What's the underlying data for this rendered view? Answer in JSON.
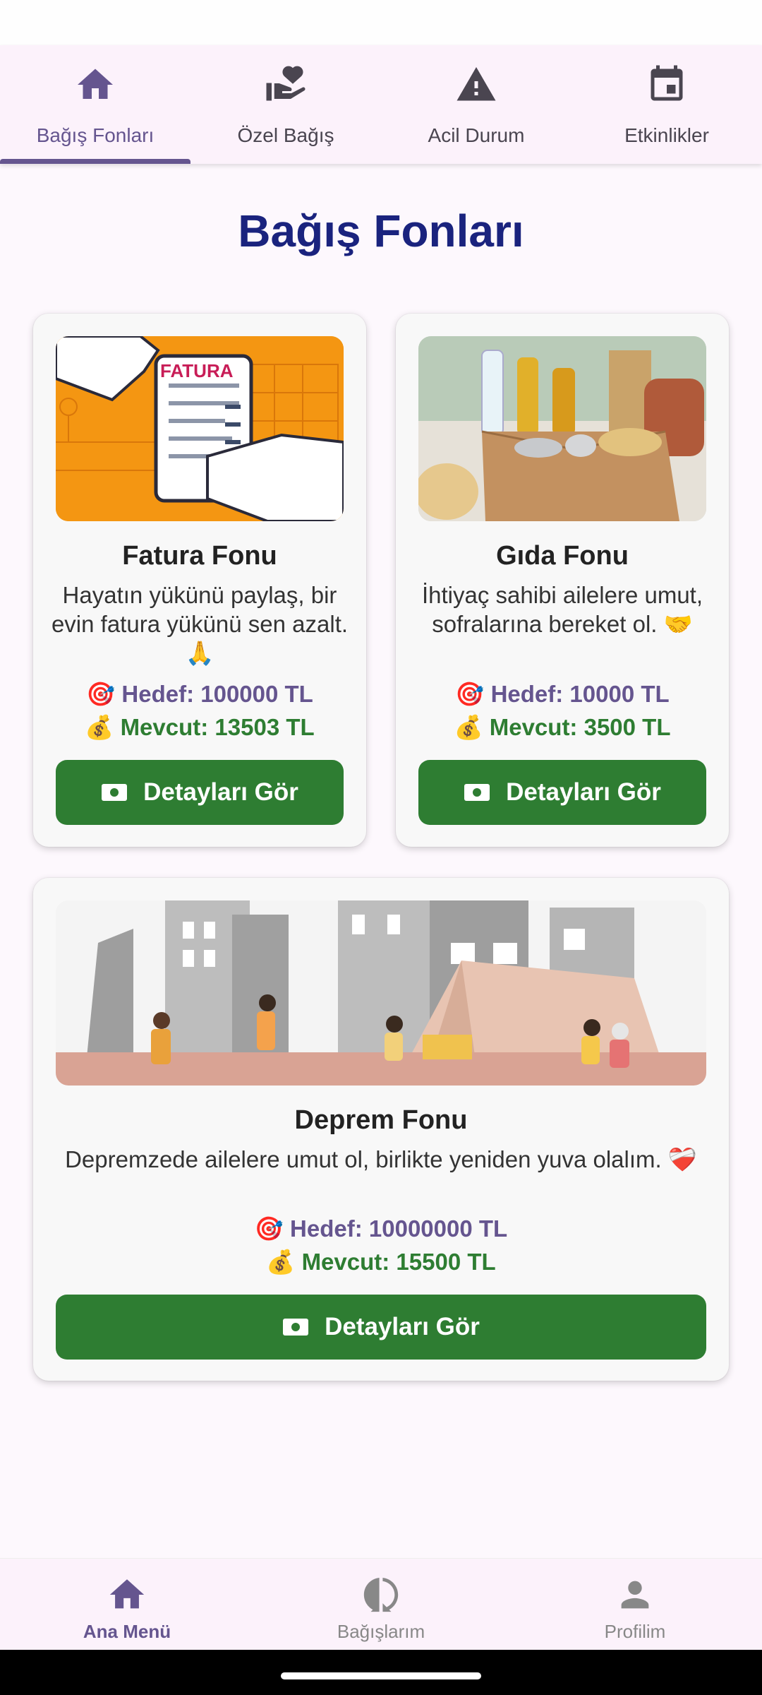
{
  "top_tabs": [
    {
      "label": "Bağış Fonları",
      "icon": "home-icon",
      "active": true
    },
    {
      "label": "Özel Bağış",
      "icon": "hand-heart-icon",
      "active": false
    },
    {
      "label": "Acil Durum",
      "icon": "warning-icon",
      "active": false
    },
    {
      "label": "Etkinlikler",
      "icon": "calendar-icon",
      "active": false
    }
  ],
  "page_title": "Bağış Fonları",
  "funds": [
    {
      "title": "Fatura Fonu",
      "image_label": "FATURA",
      "description": "Hayatın yükünü paylaş, bir evin fatura yükünü sen azalt. 🙏",
      "goal": "🎯 Hedef: 100000 TL",
      "current": "💰 Mevcut: 13503 TL",
      "button": "Detayları Gör"
    },
    {
      "title": "Gıda Fonu",
      "description": "İhtiyaç sahibi ailelere umut, sofralarına bereket ol. 🤝",
      "goal": "🎯 Hedef: 10000 TL",
      "current": "💰 Mevcut: 3500 TL",
      "button": "Detayları Gör"
    },
    {
      "title": "Deprem Fonu",
      "description": "Depremzede ailelere umut ol, birlikte yeniden yuva olalım. ❤️‍🩹",
      "goal": "🎯 Hedef: 10000000 TL",
      "current": "💰 Mevcut: 15500 TL",
      "button": "Detayları Gör"
    }
  ],
  "bottom_nav": [
    {
      "label": "Ana Menü",
      "icon": "home-icon",
      "active": true
    },
    {
      "label": "Bağışlarım",
      "icon": "progress-circle-icon",
      "active": false
    },
    {
      "label": "Profilim",
      "icon": "person-icon",
      "active": false
    }
  ],
  "colors": {
    "accent": "#65558f",
    "title": "#1a237e",
    "button": "#2e7d32",
    "surface": "#fcf2fb"
  }
}
